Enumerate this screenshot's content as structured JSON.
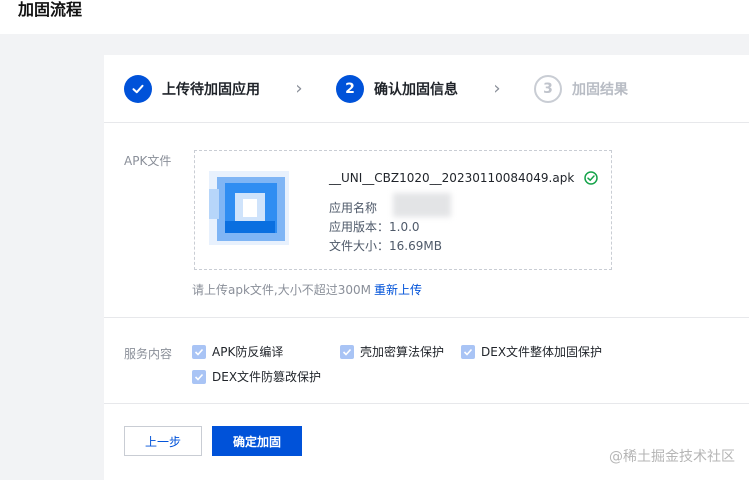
{
  "page": {
    "title": "加固流程"
  },
  "steps": [
    {
      "number": "1",
      "label": "上传待加固应用",
      "state": "done"
    },
    {
      "number": "2",
      "label": "确认加固信息",
      "state": "active"
    },
    {
      "number": "3",
      "label": "加固结果",
      "state": "pending"
    }
  ],
  "apk": {
    "section_label": "APK文件",
    "file_name": "__UNI__CBZ1020__20230110084049.apk",
    "app_name_label": "应用名称",
    "version_label": "应用版本：",
    "version_value": "1.0.0",
    "size_label": "文件大小：",
    "size_value": "16.69MB",
    "hint": "请上传apk文件,大小不超过300M",
    "reupload": "重新上传"
  },
  "services": {
    "section_label": "服务内容",
    "options": [
      {
        "label": "APK防反编译",
        "checked": true
      },
      {
        "label": "壳加密算法保护",
        "checked": true
      },
      {
        "label": "DEX文件整体加固保护",
        "checked": true
      },
      {
        "label": "DEX文件防篡改保护",
        "checked": true
      }
    ]
  },
  "actions": {
    "prev": "上一步",
    "confirm": "确定加固"
  },
  "watermark": "@稀土掘金技术社区",
  "colors": {
    "primary": "#0052d9",
    "checkbox": "#a9c4f5",
    "success": "#16a34a"
  }
}
